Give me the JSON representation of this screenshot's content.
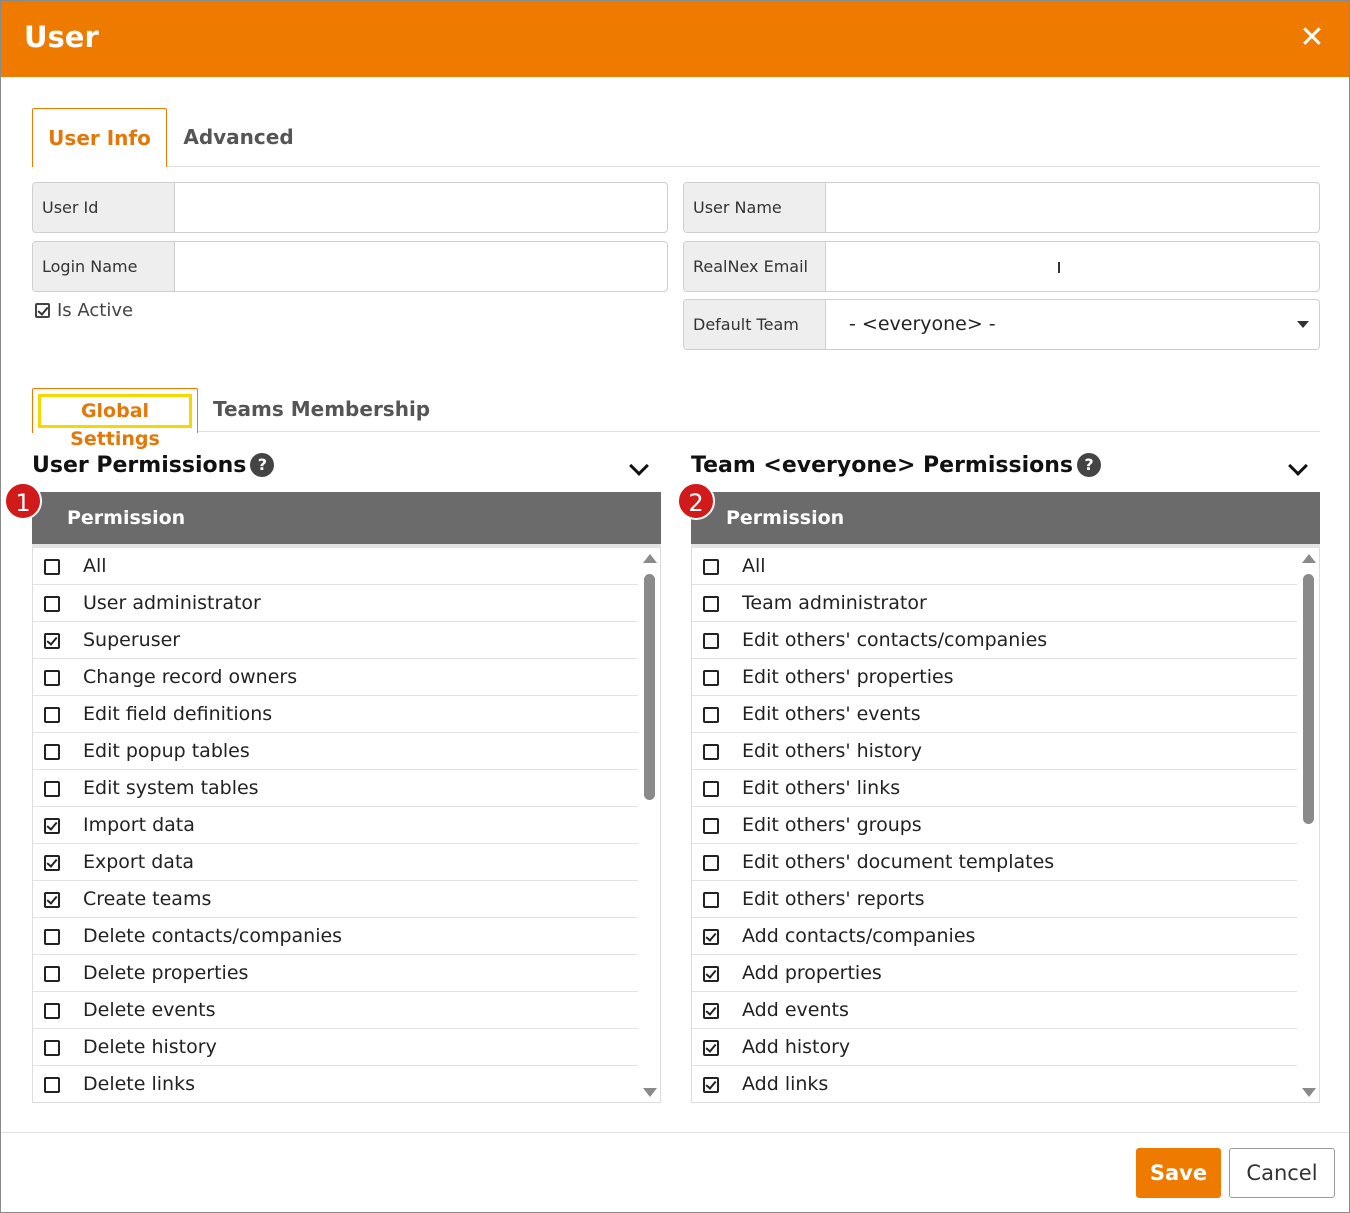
{
  "dialog": {
    "title": "User",
    "close_icon": "close-icon"
  },
  "tabs": {
    "user_info": "User Info",
    "advanced": "Advanced"
  },
  "form": {
    "user_id_label": "User Id",
    "user_id_value": "",
    "user_name_label": "User Name",
    "user_name_value": "",
    "login_name_label": "Login Name",
    "login_name_value": "",
    "realnex_email_label": "RealNex Email",
    "realnex_email_value": "",
    "default_team_label": "Default Team",
    "default_team_value": "- <everyone> -",
    "is_active_label": "Is Active",
    "is_active_checked": true
  },
  "sub_tabs": {
    "global_settings": "Global Settings",
    "teams_membership": "Teams Membership"
  },
  "user_permissions": {
    "title": "User Permissions",
    "badge": "1",
    "column_header": "Permission",
    "items": [
      {
        "label": "All",
        "checked": false
      },
      {
        "label": "User administrator",
        "checked": false
      },
      {
        "label": "Superuser",
        "checked": true
      },
      {
        "label": "Change record owners",
        "checked": false
      },
      {
        "label": "Edit field definitions",
        "checked": false
      },
      {
        "label": "Edit popup tables",
        "checked": false
      },
      {
        "label": "Edit system tables",
        "checked": false
      },
      {
        "label": "Import data",
        "checked": true
      },
      {
        "label": "Export data",
        "checked": true
      },
      {
        "label": "Create teams",
        "checked": true
      },
      {
        "label": "Delete contacts/companies",
        "checked": false
      },
      {
        "label": "Delete properties",
        "checked": false
      },
      {
        "label": "Delete events",
        "checked": false
      },
      {
        "label": "Delete history",
        "checked": false
      },
      {
        "label": "Delete links",
        "checked": false
      }
    ]
  },
  "team_permissions": {
    "title": "Team <everyone> Permissions",
    "badge": "2",
    "column_header": "Permission",
    "items": [
      {
        "label": "All",
        "checked": false
      },
      {
        "label": "Team administrator",
        "checked": false
      },
      {
        "label": "Edit others' contacts/companies",
        "checked": false
      },
      {
        "label": "Edit others' properties",
        "checked": false
      },
      {
        "label": "Edit others' events",
        "checked": false
      },
      {
        "label": "Edit others' history",
        "checked": false
      },
      {
        "label": "Edit others' links",
        "checked": false
      },
      {
        "label": "Edit others' groups",
        "checked": false
      },
      {
        "label": "Edit others' document templates",
        "checked": false
      },
      {
        "label": "Edit others' reports",
        "checked": false
      },
      {
        "label": "Add contacts/companies",
        "checked": true
      },
      {
        "label": "Add properties",
        "checked": true
      },
      {
        "label": "Add events",
        "checked": true
      },
      {
        "label": "Add history",
        "checked": true
      },
      {
        "label": "Add links",
        "checked": true
      }
    ]
  },
  "footer": {
    "save_label": "Save",
    "cancel_label": "Cancel"
  },
  "colors": {
    "accent": "#ee7a00",
    "header_gray": "#6b6b6b",
    "badge_red": "#d11a1a",
    "highlight_yellow": "#f5d800"
  }
}
